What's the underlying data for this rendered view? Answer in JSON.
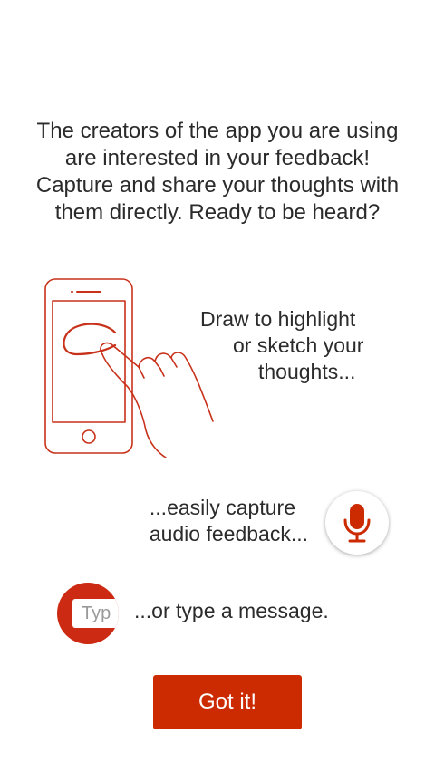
{
  "intro": {
    "lines": [
      "The creators of the app you are using",
      "are interested in your feedback!",
      "Capture and share your thoughts with",
      "them directly. Ready to be heard?"
    ]
  },
  "features": {
    "draw": {
      "lines": [
        "Draw to highlight",
        "or sketch your",
        "thoughts..."
      ],
      "icon": "phone-drawing-icon"
    },
    "audio": {
      "lines": [
        "...easily capture",
        "audio feedback..."
      ],
      "icon": "microphone-icon"
    },
    "type": {
      "field_text": "Typ",
      "label": "...or type a message.",
      "icon": "text-field-icon"
    }
  },
  "actions": {
    "got_it_label": "Got it!"
  },
  "colors": {
    "accent": "#cc2a00",
    "text": "#2b2b2b",
    "background": "#ffffff"
  }
}
